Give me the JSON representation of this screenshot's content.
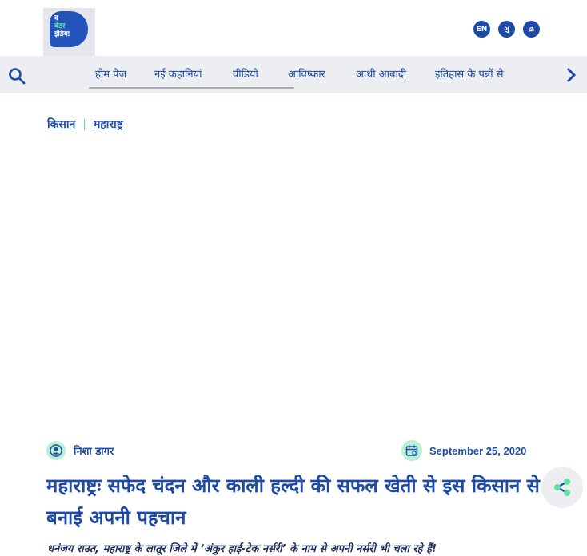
{
  "header": {
    "logo": {
      "line1": "द",
      "line2": "बेटर",
      "line3": "इंडिया"
    },
    "languages": [
      "EN",
      "ગુ",
      "മ"
    ]
  },
  "nav": {
    "items": [
      "होम पेज",
      "नई कहानियां",
      "वीडियो",
      "आविष्कार",
      "आधी आबादी",
      "इतिहास के पन्नों से"
    ]
  },
  "breadcrumb": {
    "items": [
      "किसान",
      "महाराष्ट्र"
    ],
    "separator": "|"
  },
  "article": {
    "author": "निशा डागर",
    "date": "September 25, 2020",
    "title": "महाराष्ट्रः सफेद चंदन और काली हल्दी की सफल खेती से इस किसान से बनाई अपनी पहचान",
    "summary": "धनंजय राउत, महाराष्ट्र के लातूर जिले में ‘अंकुर हाई-टेक नर्सरी’ के नाम से अपनी नर्सरी भी चला रहे हैं!"
  },
  "colors": {
    "brand_blue": "#1d4aa6",
    "accent_green": "#5fe3a1",
    "nav_bg": "#eceef1"
  },
  "icons": [
    "search-icon",
    "chevron-right-icon",
    "user-icon",
    "calendar-icon",
    "share-icon"
  ]
}
